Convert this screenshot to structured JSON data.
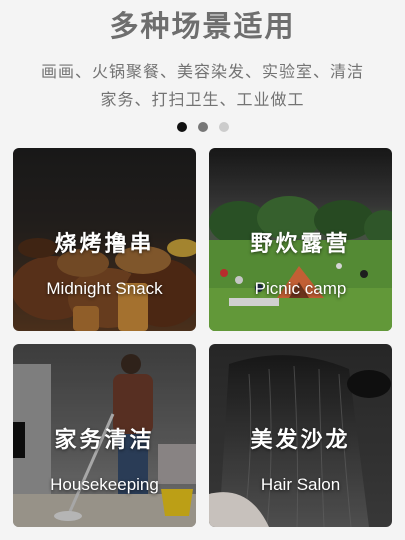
{
  "header": {
    "title": "多种场景适用",
    "subtitle_line1": "画画、火锅聚餐、美容染发、实验室、清洁",
    "subtitle_line2": "家务、打扫卫生、工业做工"
  },
  "carousel": {
    "active_color": "#111111",
    "mid_color": "#777777",
    "inactive_color": "#cccccc"
  },
  "cards": [
    {
      "title_cn": "烧烤撸串",
      "title_en": "Midnight Snack",
      "icon": "bbq-skewers-scene"
    },
    {
      "title_cn": "野炊露营",
      "title_en": "Picnic camp",
      "icon": "picnic-park-scene"
    },
    {
      "title_cn": "家务清洁",
      "title_en": "Housekeeping",
      "icon": "mopping-floor-scene"
    },
    {
      "title_cn": "美发沙龙",
      "title_en": "Hair Salon",
      "icon": "hair-salon-scene"
    }
  ]
}
